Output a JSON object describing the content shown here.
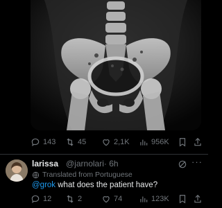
{
  "post": {
    "actions": {
      "replies": "143",
      "reposts": "45",
      "likes": "2,1K",
      "views": "956K"
    }
  },
  "reply": {
    "name": "larissa",
    "handle": "@jarnolari",
    "time": "· 6h",
    "translated": "Translated from Portuguese",
    "mention": "@grok",
    "text": " what does the patient have?",
    "actions": {
      "replies": "12",
      "reposts": "2",
      "likes": "74",
      "views": "123K"
    }
  },
  "icons": [
    "reply-icon",
    "repost-icon",
    "like-icon",
    "views-icon",
    "bookmark-icon",
    "share-icon",
    "globe-icon",
    "grok-icon",
    "more-icon"
  ]
}
